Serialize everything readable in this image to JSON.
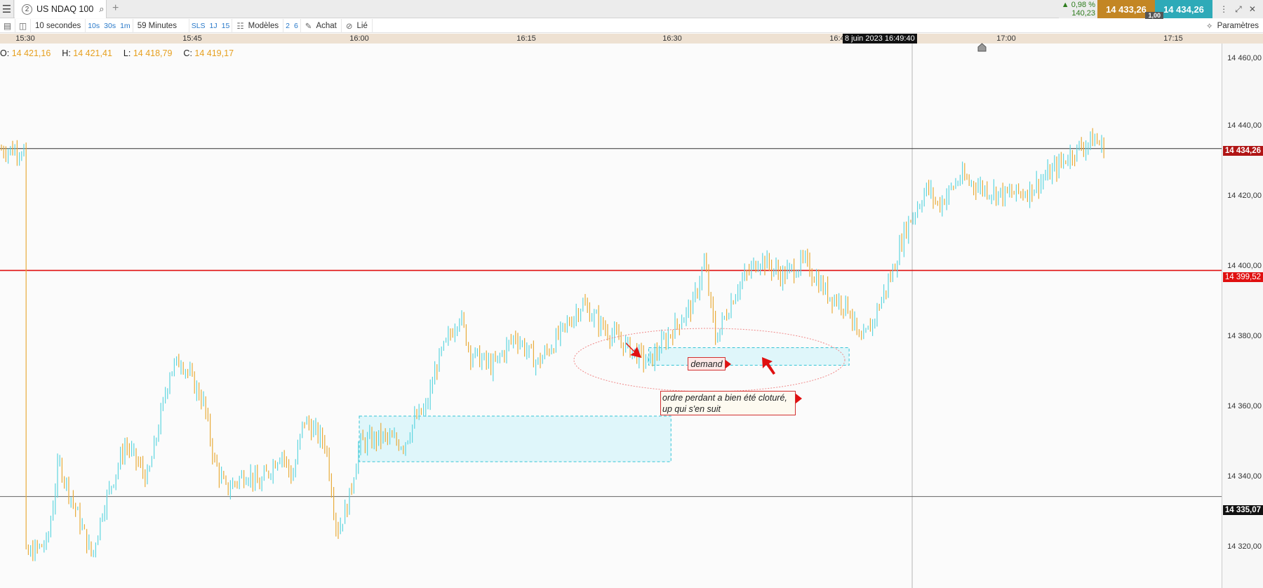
{
  "window": {
    "tab_number": "2",
    "instrument": "US NDAQ 100",
    "add_tab": "+"
  },
  "quote": {
    "change_pct": "0,98 %",
    "change_abs": "140,23",
    "bid": "14 433,26",
    "ask": "14 434,26",
    "spread": "1,00"
  },
  "toolbar": {
    "interval": "10 secondes",
    "quick_intervals": [
      "10s",
      "30s",
      "1m"
    ],
    "period": "59 Minutes",
    "sls": "SLS",
    "periods": [
      "1J",
      "15"
    ],
    "models": "Modèles",
    "numbers": [
      "2",
      "6"
    ],
    "buy": "Achat",
    "linked": "Lié",
    "settings": "Paramètres"
  },
  "ohlc": {
    "o_label": "O:",
    "o": "14 421,16",
    "h_label": "H:",
    "h": "14 421,41",
    "l_label": "L:",
    "l": "14 418,79",
    "c_label": "C:",
    "c": "14 419,17"
  },
  "crosshair_time": "8 juin 2023 16:49:40",
  "annotations": {
    "demand": "demand",
    "note_line1": "ordre perdant a bien été cloturé,",
    "note_line2": "up qui s'en suit"
  },
  "colors": {
    "up_bar": "#5fd6e0",
    "down_bar": "#e8ac3c",
    "resistance": "#e01010",
    "zone_fill": "#dff6fa",
    "zone_border": "#35c4d6",
    "bid_bg": "#c38624",
    "ask_bg": "#2eaab8"
  },
  "chart_data": {
    "type": "bar",
    "subtype": "ohlc",
    "x_ticks": [
      "15:30",
      "15:45",
      "16:00",
      "16:15",
      "16:30",
      "16:45",
      "17:00",
      "17:15"
    ],
    "y_ticks": [
      "14 460,00",
      "14 440,00",
      "14 420,00",
      "14 400,00",
      "14 380,00",
      "14 360,00",
      "14 340,00",
      "14 320,00"
    ],
    "ylim": [
      14310,
      14465
    ],
    "horizontal_lines": [
      {
        "price": 14434.26,
        "label": "14 434,26",
        "color": "#333333",
        "tag_bg": "#b01515"
      },
      {
        "price": 14399.52,
        "label": "14 399,52",
        "color": "#e01010",
        "tag_bg": "#e01010"
      },
      {
        "price": 14335.07,
        "label": "14 335,07",
        "color": "#666666",
        "tag_bg": "#111111"
      }
    ],
    "crosshair_x": "16:49:40",
    "zones": [
      {
        "name": "demand-zone",
        "t_start": "16:26",
        "t_end": "16:44",
        "y_top": 14377.5,
        "y_bottom": 14372.5
      },
      {
        "name": "demand-zone-lower",
        "t_start": "16:00",
        "t_end": "16:28",
        "y_top": 14358,
        "y_bottom": 14345
      }
    ],
    "close_path": [
      [
        "15:30",
        14318
      ],
      [
        "15:32",
        14322
      ],
      [
        "15:33",
        14345
      ],
      [
        "15:35",
        14327
      ],
      [
        "15:36",
        14318
      ],
      [
        "15:37",
        14332
      ],
      [
        "15:39",
        14350
      ],
      [
        "15:41",
        14340
      ],
      [
        "15:43",
        14371
      ],
      [
        "15:44",
        14374
      ],
      [
        "15:46",
        14362
      ],
      [
        "15:47",
        14345
      ],
      [
        "15:48",
        14337
      ],
      [
        "15:50",
        14342
      ],
      [
        "15:51",
        14338
      ],
      [
        "15:53",
        14348
      ],
      [
        "15:54",
        14340
      ],
      [
        "15:55",
        14357
      ],
      [
        "15:57",
        14350
      ],
      [
        "15:58",
        14325
      ],
      [
        "15:59",
        14333
      ],
      [
        "16:00",
        14350
      ],
      [
        "16:02",
        14352
      ],
      [
        "16:04",
        14350
      ],
      [
        "16:05",
        14357
      ],
      [
        "16:06",
        14360
      ],
      [
        "16:07",
        14373
      ],
      [
        "16:09",
        14387
      ],
      [
        "16:10",
        14376
      ],
      [
        "16:12",
        14372
      ],
      [
        "16:14",
        14381
      ],
      [
        "16:16",
        14373
      ],
      [
        "16:18",
        14381
      ],
      [
        "16:20",
        14390
      ],
      [
        "16:22",
        14383
      ],
      [
        "16:24",
        14378
      ],
      [
        "16:26",
        14373
      ],
      [
        "16:28",
        14382
      ],
      [
        "16:30",
        14390
      ],
      [
        "16:31",
        14402
      ],
      [
        "16:32",
        14380
      ],
      [
        "16:34",
        14395
      ],
      [
        "16:36",
        14403
      ],
      [
        "16:38",
        14398
      ],
      [
        "16:40",
        14402
      ],
      [
        "16:42",
        14393
      ],
      [
        "16:44",
        14389
      ],
      [
        "16:45",
        14378
      ],
      [
        "16:46",
        14384
      ],
      [
        "16:48",
        14400
      ],
      [
        "16:49",
        14411
      ],
      [
        "16:51",
        14423
      ],
      [
        "16:52",
        14418
      ],
      [
        "16:54",
        14426
      ],
      [
        "16:56",
        14423
      ],
      [
        "16:58",
        14421
      ],
      [
        "17:00",
        14422
      ],
      [
        "17:02",
        14427
      ],
      [
        "17:04",
        14433
      ],
      [
        "17:06",
        14437
      ],
      [
        "17:07",
        14434
      ]
    ]
  }
}
